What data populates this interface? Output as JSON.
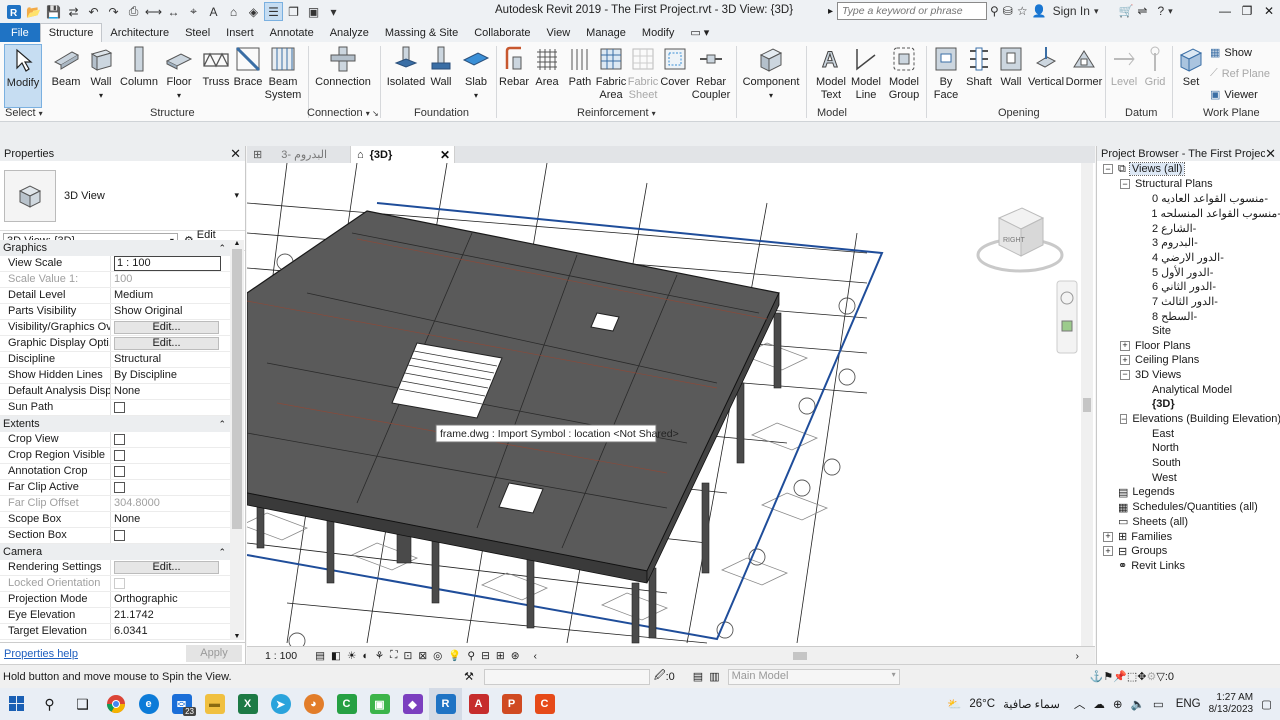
{
  "window_title": "Autodesk Revit 2019 - The First Project.rvt - 3D View: {3D}",
  "search": {
    "placeholder": "Type a keyword or phrase"
  },
  "signin_label": "Sign In",
  "ribbon_tabs": [
    "File",
    "Structure",
    "Architecture",
    "Steel",
    "Insert",
    "Annotate",
    "Analyze",
    "Massing & Site",
    "Collaborate",
    "View",
    "Manage",
    "Modify"
  ],
  "ribbon_buttons": {
    "modify": "Modify",
    "beam": "Beam",
    "wall": "Wall",
    "column": "Column",
    "floor": "Floor",
    "truss": "Truss",
    "brace": "Brace",
    "beam_system": "Beam System",
    "connection": "Connection",
    "isolated": "Isolated",
    "wall_f": "Wall",
    "slab": "Slab",
    "rebar": "Rebar",
    "area": "Area",
    "path": "Path",
    "fabric_area": "Fabric Area",
    "fabric_sheet": "Fabric Sheet",
    "cover": "Cover",
    "rebar_coupler": "Rebar Coupler",
    "component": "Component",
    "model_text": "Model Text",
    "model_line": "Model Line",
    "model_group": "Model Group",
    "by_face": "By Face",
    "shaft": "Shaft",
    "wall_o": "Wall",
    "vertical": "Vertical",
    "dormer": "Dormer",
    "level": "Level",
    "grid": "Grid",
    "set": "Set",
    "show": "Show",
    "ref_plane": "Ref  Plane",
    "viewer": "Viewer"
  },
  "panel_labels": {
    "select": "Select",
    "structure": "Structure",
    "connection": "Connection",
    "foundation": "Foundation",
    "reinforcement": "Reinforcement",
    "model": "Model",
    "opening": "Opening",
    "datum": "Datum",
    "work_plane": "Work Plane"
  },
  "properties": {
    "title": "Properties",
    "type_name": "3D View",
    "view_selector": "3D View: {3D}",
    "edit_type": "Edit Type",
    "sections": [
      {
        "name": "Graphics",
        "rows": [
          {
            "k": "View Scale",
            "v": "1 : 100",
            "kind": "input"
          },
          {
            "k": "Scale Value    1:",
            "v": "100",
            "kind": "grey"
          },
          {
            "k": "Detail Level",
            "v": "Medium"
          },
          {
            "k": "Parts Visibility",
            "v": "Show Original"
          },
          {
            "k": "Visibility/Graphics Ov...",
            "v": "Edit...",
            "kind": "button"
          },
          {
            "k": "Graphic Display Opti...",
            "v": "Edit...",
            "kind": "button"
          },
          {
            "k": "Discipline",
            "v": "Structural"
          },
          {
            "k": "Show Hidden Lines",
            "v": "By Discipline"
          },
          {
            "k": "Default Analysis Displ...",
            "v": "None"
          },
          {
            "k": "Sun Path",
            "v": "",
            "kind": "check"
          }
        ]
      },
      {
        "name": "Extents",
        "rows": [
          {
            "k": "Crop View",
            "v": "",
            "kind": "check"
          },
          {
            "k": "Crop Region Visible",
            "v": "",
            "kind": "check"
          },
          {
            "k": "Annotation Crop",
            "v": "",
            "kind": "check"
          },
          {
            "k": "Far Clip Active",
            "v": "",
            "kind": "check"
          },
          {
            "k": "Far Clip Offset",
            "v": "304.8000",
            "kind": "grey"
          },
          {
            "k": "Scope Box",
            "v": "None"
          },
          {
            "k": "Section Box",
            "v": "",
            "kind": "check"
          }
        ]
      },
      {
        "name": "Camera",
        "rows": [
          {
            "k": "Rendering Settings",
            "v": "Edit...",
            "kind": "button"
          },
          {
            "k": "Locked Orientation",
            "v": "",
            "kind": "greycheck"
          },
          {
            "k": "Projection Mode",
            "v": "Orthographic"
          },
          {
            "k": "Eye Elevation",
            "v": "21.1742"
          },
          {
            "k": "Target Elevation",
            "v": "6.0341"
          }
        ]
      }
    ],
    "help_link": "Properties help",
    "apply": "Apply"
  },
  "view_tabs": [
    {
      "label": "البدروم -3",
      "active": false
    },
    {
      "label": "{3D}",
      "active": true
    }
  ],
  "viewcube_label": "RIGHT",
  "tooltip": "frame.dwg : Import Symbol : location <Not Shared>",
  "view_scale": "1 : 100",
  "project_browser": {
    "title": "Project Browser - The First Project.rvt",
    "nodes": [
      {
        "label": "Views (all)",
        "level": 0,
        "toggle": "−",
        "icon": "views-icon",
        "selected": true
      },
      {
        "label": "Structural Plans",
        "level": 1,
        "toggle": "−"
      },
      {
        "label": "منسوب القواعد العاديه 0-",
        "level": 2
      },
      {
        "label": "منسوب القواعد المنسلحه 1-",
        "level": 2
      },
      {
        "label": "الشارع 2-",
        "level": 2
      },
      {
        "label": "البدروم 3-",
        "level": 2
      },
      {
        "label": "الدور الارضي 4-",
        "level": 2
      },
      {
        "label": "الدور الأول 5-",
        "level": 2
      },
      {
        "label": "الدور الثاني 6-",
        "level": 2
      },
      {
        "label": "الدور الثالث 7-",
        "level": 2
      },
      {
        "label": "السطح 8-",
        "level": 2
      },
      {
        "label": "Site",
        "level": 2
      },
      {
        "label": "Floor Plans",
        "level": 1,
        "toggle": "+"
      },
      {
        "label": "Ceiling Plans",
        "level": 1,
        "toggle": "+"
      },
      {
        "label": "3D Views",
        "level": 1,
        "toggle": "−"
      },
      {
        "label": "Analytical Model",
        "level": 2
      },
      {
        "label": "{3D}",
        "level": 2,
        "bold": true
      },
      {
        "label": "Elevations (Building Elevation)",
        "level": 1,
        "toggle": "−"
      },
      {
        "label": "East",
        "level": 2
      },
      {
        "label": "North",
        "level": 2
      },
      {
        "label": "South",
        "level": 2
      },
      {
        "label": "West",
        "level": 2
      },
      {
        "label": "Legends",
        "level": 0,
        "icon": "legend-icon"
      },
      {
        "label": "Schedules/Quantities (all)",
        "level": 0,
        "icon": "schedule-icon"
      },
      {
        "label": "Sheets (all)",
        "level": 0,
        "icon": "sheet-icon"
      },
      {
        "label": "Families",
        "level": 0,
        "toggle": "+",
        "icon": "family-icon"
      },
      {
        "label": "Groups",
        "level": 0,
        "toggle": "+",
        "icon": "group-icon"
      },
      {
        "label": "Revit Links",
        "level": 0,
        "icon": "link-icon"
      }
    ]
  },
  "status": {
    "text": "Hold button and move mouse to Spin the View.",
    "zero": ":0",
    "model": "Main Model",
    "filter": ":0"
  },
  "taskbar": {
    "weather_temp": "26°C",
    "weather_text": "سماء صافية",
    "lang": "ENG",
    "time": "1:27 AM",
    "date": "8/13/2023",
    "badge": "23"
  }
}
